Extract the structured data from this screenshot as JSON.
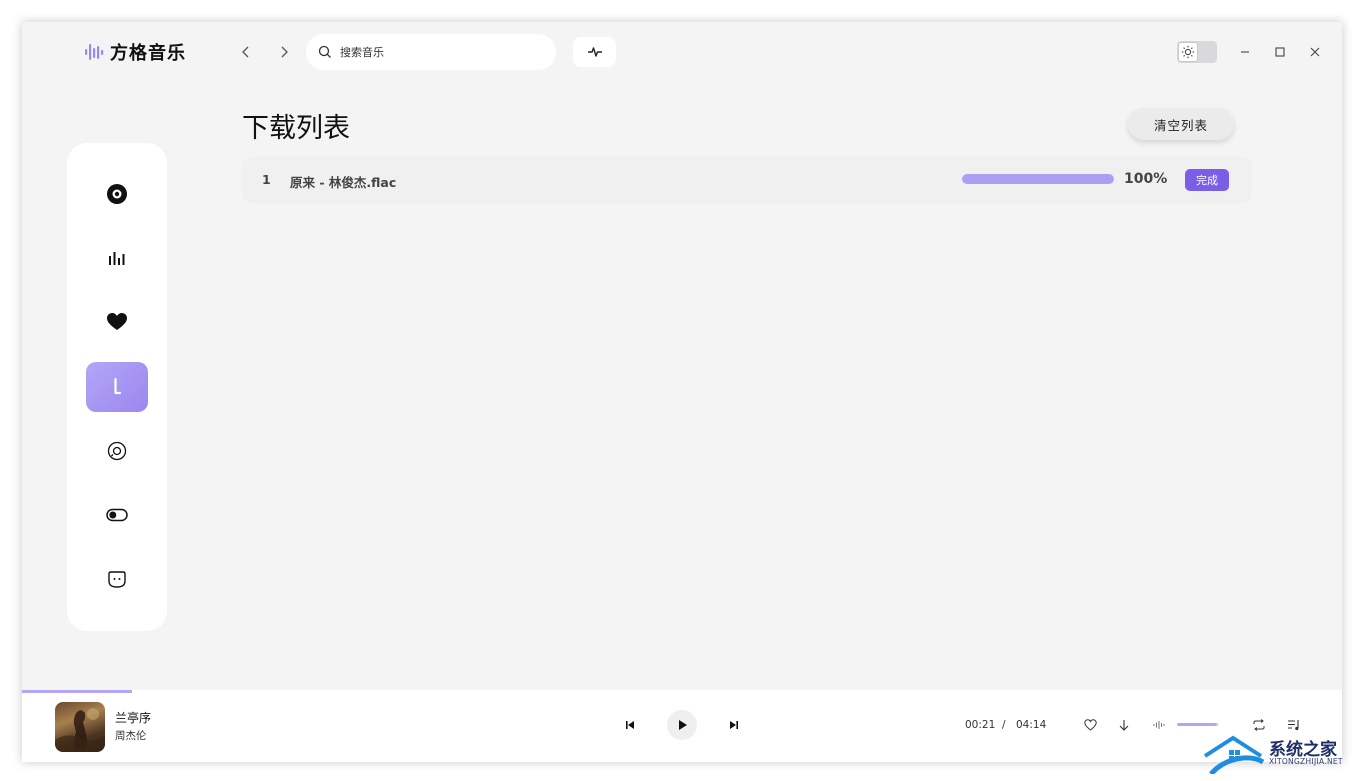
{
  "app": {
    "name": "方格音乐",
    "accent_color": "#9a87ef"
  },
  "header": {
    "search": {
      "placeholder": "搜索音乐",
      "value": ""
    },
    "back_icon": "chevron-left-icon",
    "forward_icon": "chevron-right-icon",
    "pulse_icon": "pulse-icon",
    "theme_icon": "sun-icon"
  },
  "window_controls": [
    "minimize-icon",
    "maximize-icon",
    "close-icon"
  ],
  "sidebar": {
    "items": [
      {
        "icon": "disc-icon",
        "active": false
      },
      {
        "icon": "equalizer-icon",
        "active": false
      },
      {
        "icon": "heart-icon",
        "active": false
      },
      {
        "icon": "download-icon",
        "active": true
      },
      {
        "icon": "cd-icon",
        "active": false
      },
      {
        "icon": "toggle-icon",
        "active": false
      },
      {
        "icon": "face-icon",
        "active": false
      }
    ]
  },
  "main": {
    "title": "下载列表",
    "clear_label": "清空列表",
    "downloads": [
      {
        "index": "1",
        "name": "原来 - 林俊杰.flac",
        "progress": 1.0,
        "percent": "100%",
        "status": "完成"
      }
    ]
  },
  "player": {
    "title": "兰亭序",
    "artist": "周杰伦",
    "progress": 0.083,
    "current_time": "00:21",
    "separator": "/",
    "total_time": "04:14",
    "volume": 0.95
  },
  "watermark": {
    "text": "系统之家",
    "sub": "XITONGZHIJIA.NET"
  }
}
